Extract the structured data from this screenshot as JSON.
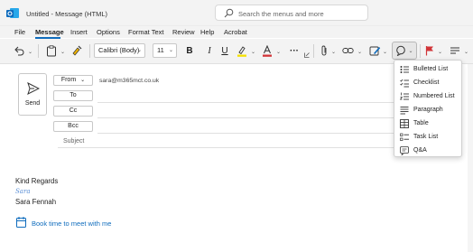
{
  "window": {
    "title": "Untitled - Message (HTML)"
  },
  "search": {
    "placeholder": "Search the menus and more"
  },
  "menu": {
    "items": [
      "File",
      "Message",
      "Insert",
      "Options",
      "Format Text",
      "Review",
      "Help",
      "Acrobat"
    ],
    "active": "Message"
  },
  "ribbon": {
    "font_name": "Calibri (Body)",
    "font_size": "11",
    "bold": "B",
    "italic": "I",
    "underline": "U",
    "more": "···",
    "highlight_color": "#f5e100",
    "font_color": "#d13438"
  },
  "header": {
    "send_label": "Send",
    "from_label": "From",
    "from_chevron": "⌄",
    "from_address": "sara@m365mct.co.uk",
    "to_label": "To",
    "cc_label": "Cc",
    "bcc_label": "Bcc",
    "subject_label": "Subject"
  },
  "body": {
    "line1": "Kind Regards",
    "signature_script": "Sara",
    "name": "Sara Fennah",
    "booking_link": "Book time to meet with me"
  },
  "dropdown": {
    "items": [
      {
        "label": "Bulleted List",
        "icon": "bulleted-list-icon"
      },
      {
        "label": "Checklist",
        "icon": "checklist-icon"
      },
      {
        "label": "Numbered List",
        "icon": "numbered-list-icon"
      },
      {
        "label": "Paragraph",
        "icon": "paragraph-icon"
      },
      {
        "label": "Table",
        "icon": "table-icon"
      },
      {
        "label": "Task List",
        "icon": "task-list-icon"
      },
      {
        "label": "Q&A",
        "icon": "qa-icon"
      }
    ]
  },
  "colors": {
    "accent": "#0f6cbd",
    "flag": "#d13438"
  }
}
